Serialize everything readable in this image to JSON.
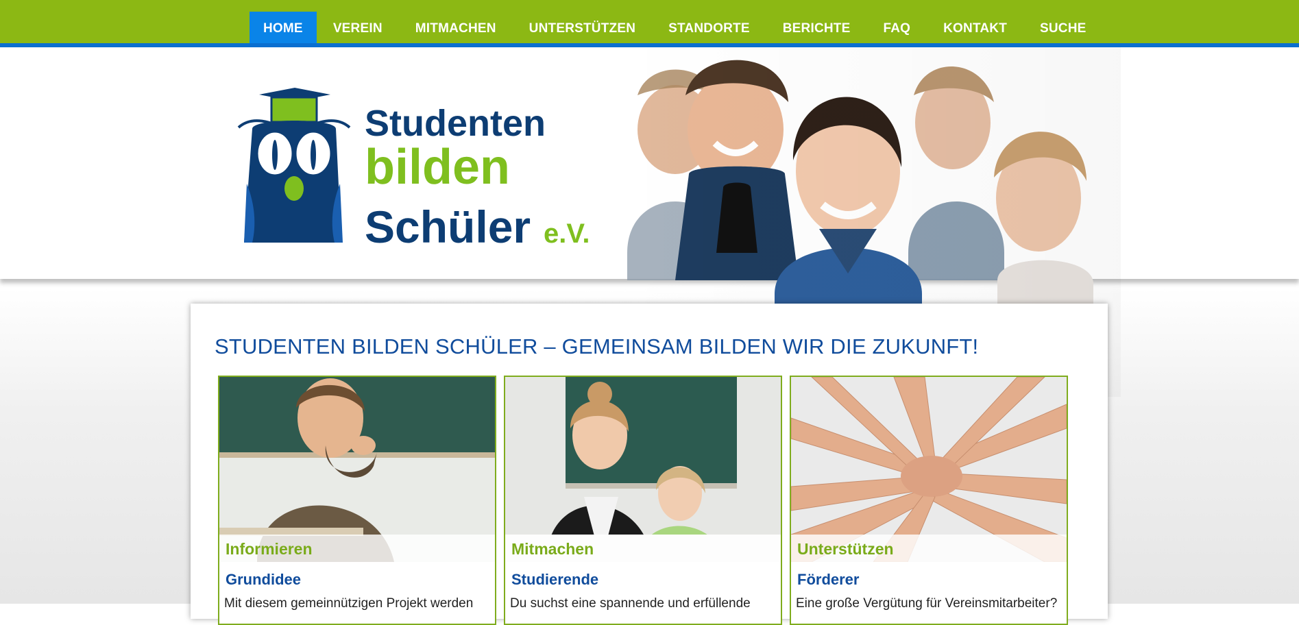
{
  "nav": {
    "items": [
      {
        "label": "HOME",
        "active": true
      },
      {
        "label": "VEREIN"
      },
      {
        "label": "MITMACHEN"
      },
      {
        "label": "UNTERSTÜTZEN"
      },
      {
        "label": "STANDORTE"
      },
      {
        "label": "BERICHTE"
      },
      {
        "label": "FAQ"
      },
      {
        "label": "KONTAKT"
      },
      {
        "label": "SUCHE"
      }
    ]
  },
  "logo": {
    "line1": "Studenten",
    "line2": "bilden",
    "line3": "Schüler",
    "suffix": "e.V."
  },
  "main": {
    "title": "STUDENTEN BILDEN SCHÜLER – GEMEINSAM BILDEN WIR DIE ZUKUNFT!",
    "cards": [
      {
        "category": "Informieren",
        "subtitle": "Grundidee",
        "text": "Mit diesem gemeinnützigen Projekt werden"
      },
      {
        "category": "Mitmachen",
        "subtitle": "Studierende",
        "text": "Du suchst eine spannende und erfüllende"
      },
      {
        "category": "Unterstützen",
        "subtitle": "Förderer",
        "text": "Eine große Vergütung für Vereinsmitarbeiter?"
      }
    ]
  },
  "colors": {
    "nav_green": "#8cb814",
    "nav_active_blue": "#0a84e8",
    "nav_border_blue": "#0a6fd0",
    "title_blue": "#104c9c",
    "accent_green": "#7aab1a"
  }
}
